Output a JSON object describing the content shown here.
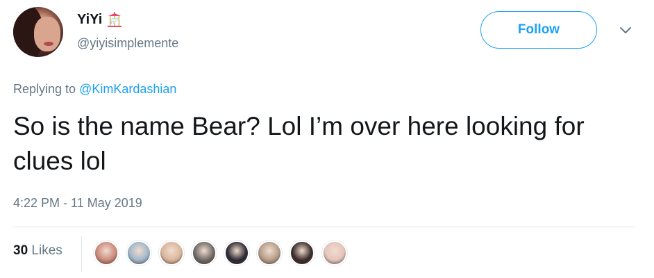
{
  "user": {
    "display_name": "YiYi",
    "handle": "@yiyisimplemente",
    "name_emoji": "carousel-horse-icon"
  },
  "actions": {
    "follow_label": "Follow",
    "menu_icon": "chevron-down-icon"
  },
  "reply": {
    "prefix": "Replying to",
    "mention": "@KimKardashian"
  },
  "tweet": {
    "text": "So is the name Bear? Lol I’m over here looking for clues lol",
    "timestamp": "4:22 PM - 11 May 2019"
  },
  "stats": {
    "likes_count": "30",
    "likes_label": "Likes"
  },
  "likers": [
    {
      "color": "#c98a79"
    },
    {
      "color": "#9fb6c9"
    },
    {
      "color": "#d9b59c"
    },
    {
      "color": "#6f6a67"
    },
    {
      "color": "#2d2a33"
    },
    {
      "color": "#b49c86"
    },
    {
      "color": "#3a2c2a"
    },
    {
      "color": "#e3c4bb"
    }
  ],
  "colors": {
    "accent": "#1da1f2",
    "secondary_text": "#657786",
    "primary_text": "#14171a",
    "divider": "#e1e8ed"
  }
}
